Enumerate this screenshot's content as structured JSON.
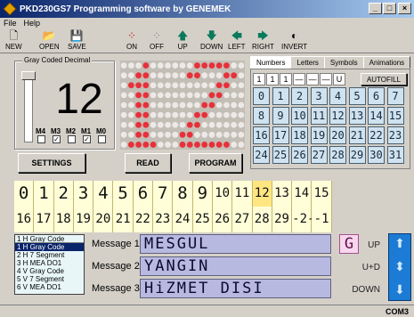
{
  "window": {
    "title": "PKD230GS7 Programming software by GENEMEK",
    "min": "_",
    "max": "□",
    "close": "×"
  },
  "menu": [
    "File",
    "Help"
  ],
  "toolbar": [
    {
      "label": "NEW",
      "icon": "new-file-icon",
      "glyph": "🗋"
    },
    {
      "label": "OPEN",
      "icon": "open-folder-icon",
      "glyph": "📂"
    },
    {
      "label": "SAVE",
      "icon": "floppy-icon",
      "glyph": "💾"
    },
    {
      "label": "ON",
      "icon": "dots-on-icon",
      "glyph": "⁘"
    },
    {
      "label": "OFF",
      "icon": "dots-off-icon",
      "glyph": "⁘"
    },
    {
      "label": "UP",
      "icon": "arrow-up-icon",
      "glyph": "🡅"
    },
    {
      "label": "DOWN",
      "icon": "arrow-down-icon",
      "glyph": "🡇"
    },
    {
      "label": "LEFT",
      "icon": "arrow-left-icon",
      "glyph": "🡄"
    },
    {
      "label": "RIGHT",
      "icon": "arrow-right-icon",
      "glyph": "🡆"
    },
    {
      "label": "INVERT",
      "icon": "invert-icon",
      "glyph": "◐"
    }
  ],
  "gray": {
    "group_title": "Gray Coded Decimal",
    "value": "12",
    "slider_level": 1.0,
    "bits": [
      {
        "label": "M4",
        "checked": false
      },
      {
        "label": "M3",
        "checked": true
      },
      {
        "label": "M2",
        "checked": false
      },
      {
        "label": "M1",
        "checked": true
      },
      {
        "label": "M0",
        "checked": false
      }
    ],
    "check_mark": "✓"
  },
  "buttons": {
    "settings": "SETTINGS",
    "read": "READ",
    "program": "PROGRAM"
  },
  "matrix": {
    "on_color": "#e8303a",
    "off_color": "#ece9e6"
  },
  "tabs": [
    "Numbers",
    "Letters",
    "Symbols",
    "Animations"
  ],
  "seg_buttons": [
    "1",
    "1",
    "1",
    "—",
    "—",
    "—",
    "U"
  ],
  "autofill": "AUTOFILL",
  "number_grid": [
    "0",
    "1",
    "2",
    "3",
    "4",
    "5",
    "6",
    "7",
    "8",
    "9",
    "10",
    "11",
    "12",
    "13",
    "14",
    "15",
    "16",
    "17",
    "18",
    "19",
    "20",
    "21",
    "22",
    "23",
    "24",
    "25",
    "26",
    "27",
    "28",
    "29",
    "30",
    "31"
  ],
  "strip1": [
    "0",
    "1",
    "2",
    "3",
    "4",
    "5",
    "6",
    "7",
    "8",
    "9",
    "10",
    "11",
    "12",
    "13",
    "14",
    "15"
  ],
  "strip2": [
    "16",
    "17",
    "18",
    "19",
    "20",
    "21",
    "22",
    "23",
    "24",
    "25",
    "26",
    "27",
    "28",
    "29",
    "-2-",
    "-1"
  ],
  "highlight_index": 12,
  "code_list": [
    "1 H Gray Code",
    "1 H Gray Code",
    "2 H 7 Segment",
    "3 H MEA DO1",
    "4 V Gray Code",
    "5 V 7 Segment",
    "6 V MEA DO1"
  ],
  "messages": [
    {
      "label": "Message 1",
      "text": "MESGUL"
    },
    {
      "label": "Message 2",
      "text": "YANGIN"
    },
    {
      "label": "Message 3",
      "text": "HiZMET DISI"
    }
  ],
  "badge": "G",
  "side_labels": {
    "up": "UP",
    "ud": "U+D",
    "down": "DOWN"
  },
  "status": {
    "port": "COM3"
  }
}
